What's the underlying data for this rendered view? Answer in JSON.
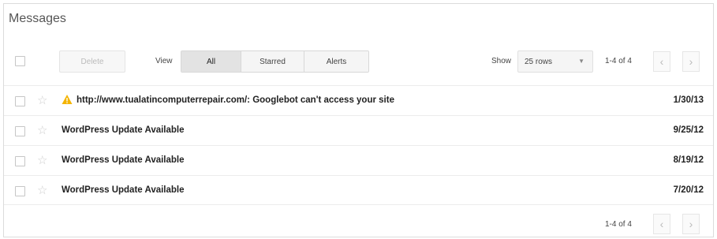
{
  "header": {
    "title": "Messages"
  },
  "toolbar": {
    "delete_label": "Delete",
    "view_label": "View",
    "tabs": [
      {
        "label": "All",
        "active": true
      },
      {
        "label": "Starred",
        "active": false
      },
      {
        "label": "Alerts",
        "active": false
      }
    ],
    "show_label": "Show",
    "rows_selected": "25 rows",
    "pagination_text": "1-4 of 4"
  },
  "messages": [
    {
      "subject": "http://www.tualatincomputerrepair.com/: Googlebot can't access your site",
      "date": "1/30/13",
      "warning": true
    },
    {
      "subject": "WordPress Update Available",
      "date": "9/25/12",
      "warning": false
    },
    {
      "subject": "WordPress Update Available",
      "date": "8/19/12",
      "warning": false
    },
    {
      "subject": "WordPress Update Available",
      "date": "7/20/12",
      "warning": false
    }
  ],
  "footer": {
    "pagination_text": "1-4 of 4"
  },
  "colors": {
    "warning": "#f4b400",
    "star": "#cfcfcf",
    "border": "#dcdcdc"
  }
}
